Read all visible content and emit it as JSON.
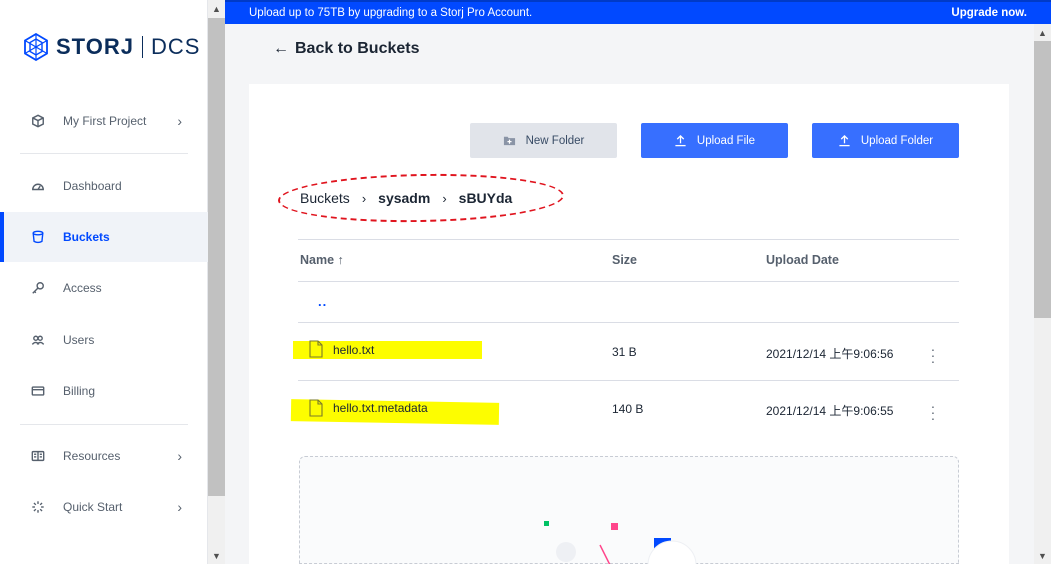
{
  "banner": {
    "text": "Upload up to 75TB by upgrading to a Storj Pro Account.",
    "upgrade": "Upgrade now."
  },
  "logo": {
    "brand": "STORJ",
    "product": "DCS"
  },
  "sidebar": {
    "project": "My First Project",
    "items": [
      {
        "label": "Dashboard",
        "icon": "dashboard-icon"
      },
      {
        "label": "Buckets",
        "icon": "bucket-icon",
        "active": true
      },
      {
        "label": "Access",
        "icon": "key-icon"
      },
      {
        "label": "Users",
        "icon": "users-icon"
      },
      {
        "label": "Billing",
        "icon": "card-icon"
      }
    ],
    "resources": "Resources",
    "quick_start": "Quick Start"
  },
  "main": {
    "back_label": "Back to Buckets",
    "buttons": {
      "new_folder": "New Folder",
      "upload_file": "Upload File",
      "upload_folder": "Upload Folder"
    },
    "breadcrumb": [
      "Buckets",
      "sysadm",
      "sBUYda"
    ],
    "table": {
      "headers": {
        "name": "Name ↑",
        "size": "Size",
        "date": "Upload Date"
      },
      "updir": "..",
      "rows": [
        {
          "name": "hello.txt",
          "size": "31 B",
          "date": "2021/12/14 上午9:06:56"
        },
        {
          "name": "hello.txt.metadata",
          "size": "140 B",
          "date": "2021/12/14 上午9:06:55"
        }
      ]
    }
  },
  "colors": {
    "primary": "#0149ff",
    "button_blue": "#376fff",
    "highlight": "#fdfd00",
    "annotation_red": "#e0141e"
  }
}
